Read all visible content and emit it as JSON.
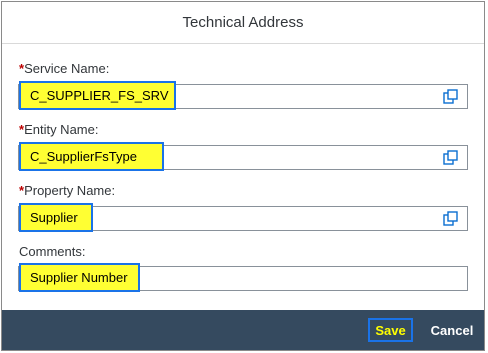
{
  "dialog": {
    "title": "Technical Address"
  },
  "fields": [
    {
      "required_mark": "*",
      "label": "Service Name:",
      "value": "C_SUPPLIER_FS_SRV",
      "icon": "value-help-icon"
    },
    {
      "required_mark": "*",
      "label": "Entity Name:",
      "value": "C_SupplierFsType",
      "icon": "value-help-icon"
    },
    {
      "required_mark": "*",
      "label": "Property Name:",
      "value": "Supplier",
      "icon": "value-help-icon"
    },
    {
      "required_mark": "",
      "label": "Comments:",
      "value": "Supplier Number"
    }
  ],
  "footer": {
    "save_label": "Save",
    "cancel_label": "Cancel"
  },
  "colors": {
    "highlight": "#ffff33",
    "highlight_border": "#1a73e8",
    "footer_bg": "#354a5f",
    "required": "#bb0000",
    "save_text": "#ffff00"
  }
}
